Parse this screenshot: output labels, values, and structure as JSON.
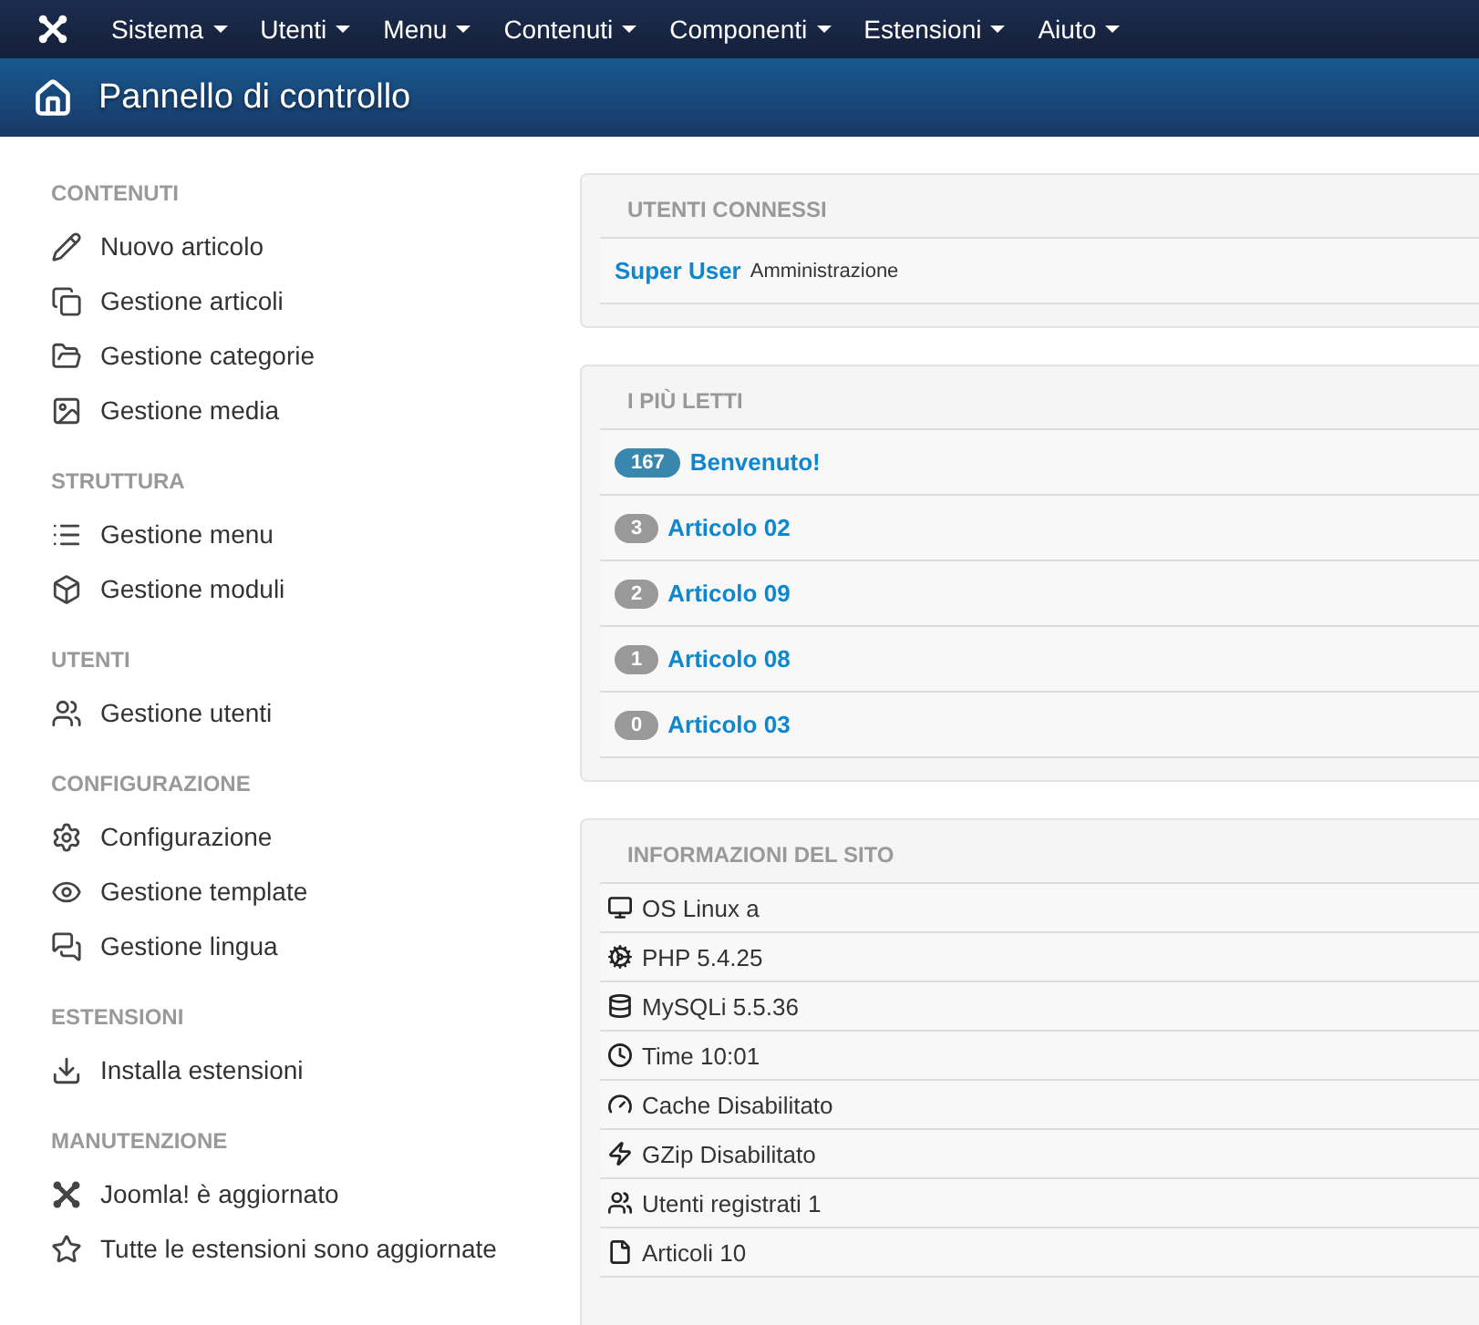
{
  "menu": [
    {
      "label": "Sistema"
    },
    {
      "label": "Utenti"
    },
    {
      "label": "Menu"
    },
    {
      "label": "Contenuti"
    },
    {
      "label": "Componenti"
    },
    {
      "label": "Estensioni"
    },
    {
      "label": "Aiuto"
    }
  ],
  "page_title": "Pannello di controllo",
  "sidebar": [
    {
      "title": "CONTENUTI",
      "items": [
        "Nuovo articolo",
        "Gestione articoli",
        "Gestione categorie",
        "Gestione media"
      ]
    },
    {
      "title": "STRUTTURA",
      "items": [
        "Gestione menu",
        "Gestione moduli"
      ]
    },
    {
      "title": "UTENTI",
      "items": [
        "Gestione utenti"
      ]
    },
    {
      "title": "CONFIGURAZIONE",
      "items": [
        "Configurazione",
        "Gestione template",
        "Gestione lingua"
      ]
    },
    {
      "title": "ESTENSIONI",
      "items": [
        "Installa estensioni"
      ]
    },
    {
      "title": "MANUTENZIONE",
      "items": [
        "Joomla! è aggiornato",
        "Tutte le estensioni sono aggiornate"
      ]
    }
  ],
  "logged_users": {
    "title": "UTENTI CONNESSI",
    "rows": [
      {
        "name": "Super User",
        "area": "Amministrazione"
      }
    ]
  },
  "popular": {
    "title": "I PIÙ LETTI",
    "rows": [
      {
        "hits": "167",
        "title": "Benvenuto!",
        "color": "#3a87ad"
      },
      {
        "hits": "3",
        "title": "Articolo 02",
        "color": "#999999"
      },
      {
        "hits": "2",
        "title": "Articolo 09",
        "color": "#999999"
      },
      {
        "hits": "1",
        "title": "Articolo 08",
        "color": "#999999"
      },
      {
        "hits": "0",
        "title": "Articolo 03",
        "color": "#999999"
      }
    ]
  },
  "site_info": {
    "title": "INFORMAZIONI DEL SITO",
    "rows": [
      "OS Linux a",
      "PHP 5.4.25",
      "MySQLi 5.5.36",
      "Time 10:01",
      "Cache Disabilitato",
      "GZip Disabilitato",
      "Utenti registrati 1",
      "Articoli 10"
    ]
  }
}
